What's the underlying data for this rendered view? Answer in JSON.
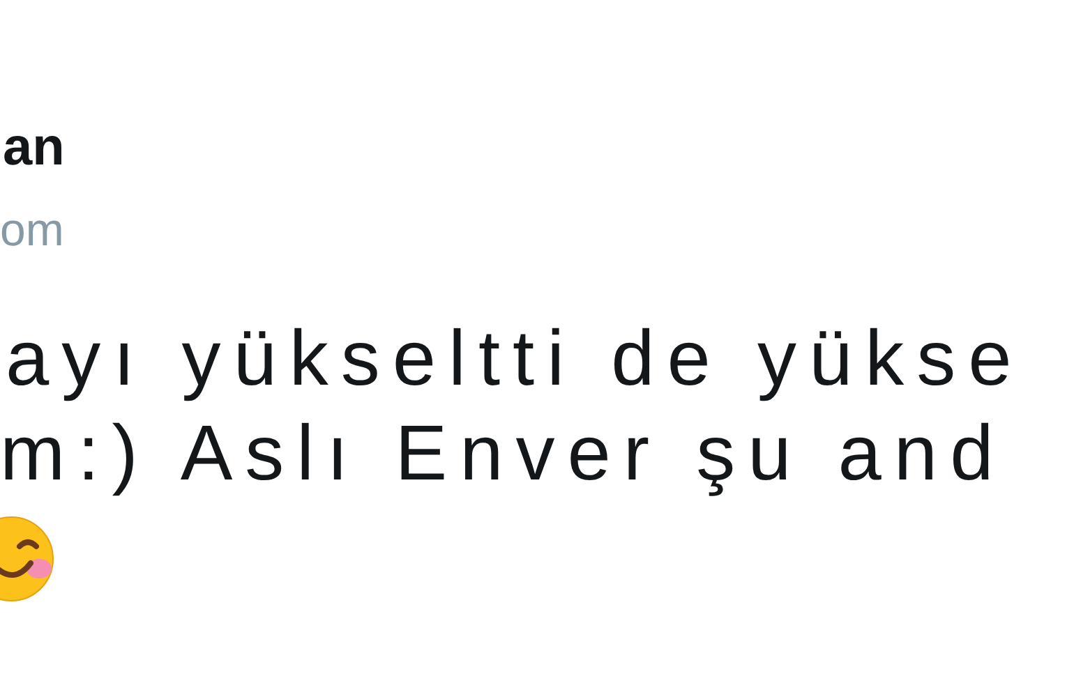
{
  "author": {
    "name": "an",
    "handle": "om"
  },
  "tweet": {
    "lines": [
      "ayı yükseltti de yükse",
      "m:) Aslı Enver şu and"
    ],
    "emoji": true
  }
}
